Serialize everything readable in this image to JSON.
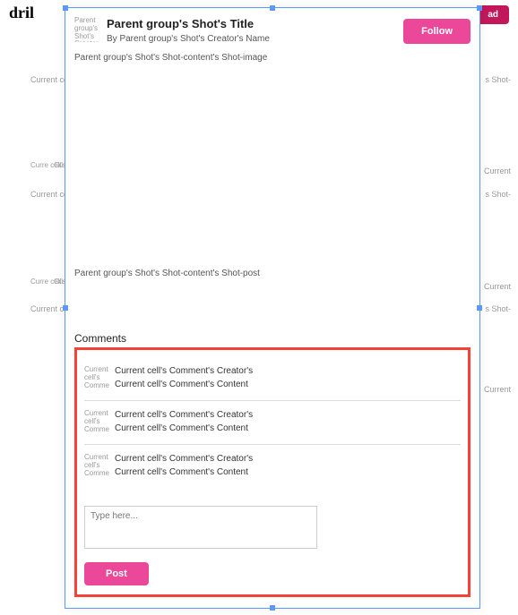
{
  "header": {
    "logo": "dril",
    "top_button": "ad"
  },
  "bg": {
    "thumb_text": "Current cell's Shot-image",
    "thumb_short": "Curre cell's",
    "thumb_cu": "Cu",
    "side_short": "s Shot-",
    "side_current": "Current"
  },
  "shot": {
    "avatar_text": "Parent group's Shot's Creator",
    "title": "Parent group's Shot's Title",
    "creator": "By Parent group's Shot's Creator's Name",
    "follow": "Follow",
    "image_label": "Parent group's Shot's Shot-content's Shot-image",
    "post": "Parent group's Shot's Shot-content's Shot-post"
  },
  "comments": {
    "title": "Comments",
    "items": [
      {
        "avatar": "Current cell's Comme",
        "creator": "Current cell's Comment's Creator's",
        "content": "Current cell's Comment's Content"
      },
      {
        "avatar": "Current cell's Comme",
        "creator": "Current cell's Comment's Creator's",
        "content": "Current cell's Comment's Content"
      },
      {
        "avatar": "Current cell's Comme",
        "creator": "Current cell's Comment's Creator's",
        "content": "Current cell's Comment's Content"
      }
    ],
    "input_placeholder": "Type here...",
    "post_button": "Post"
  }
}
